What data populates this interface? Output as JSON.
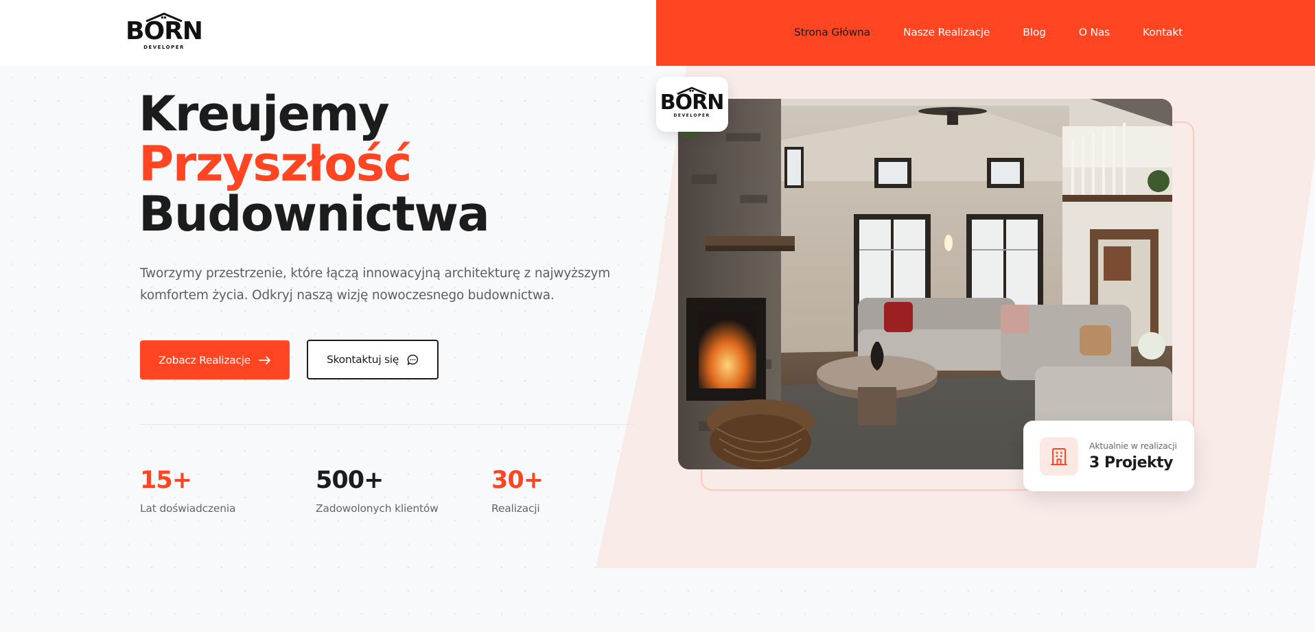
{
  "brand": {
    "logo_word": "BORN",
    "logo_sub": "DEVELOPER",
    "accent_color": "#ff4521"
  },
  "nav": {
    "items": [
      {
        "label": "Strona Główna",
        "active": true
      },
      {
        "label": "Nasze Realizacje",
        "active": false
      },
      {
        "label": "Blog",
        "active": false
      },
      {
        "label": "O Nas",
        "active": false
      },
      {
        "label": "Kontakt",
        "active": false
      }
    ]
  },
  "hero": {
    "title_line1": "Kreujemy",
    "title_line2": "Przyszłość",
    "title_line3": "Budownictwa",
    "description": "Tworzymy przestrzenie, które łączą innowacyjną architekturę z najwyższym komfortem życia. Odkryj naszą wizję nowoczesnego budownictwa.",
    "primary_button": "Zobacz Realizacje",
    "primary_button_icon": "arrow-right-icon",
    "secondary_button": "Skontaktuj się",
    "secondary_button_icon": "chat-bubble-icon"
  },
  "stats": [
    {
      "value": "15+",
      "label": "Lat doświadczenia"
    },
    {
      "value": "500+",
      "label": "Zadowolonych klientów"
    },
    {
      "value": "30+",
      "label": "Realizacji"
    }
  ],
  "status_card": {
    "icon": "building-icon",
    "caption": "Aktualnie w realizacji",
    "value": "3 Projekty"
  }
}
